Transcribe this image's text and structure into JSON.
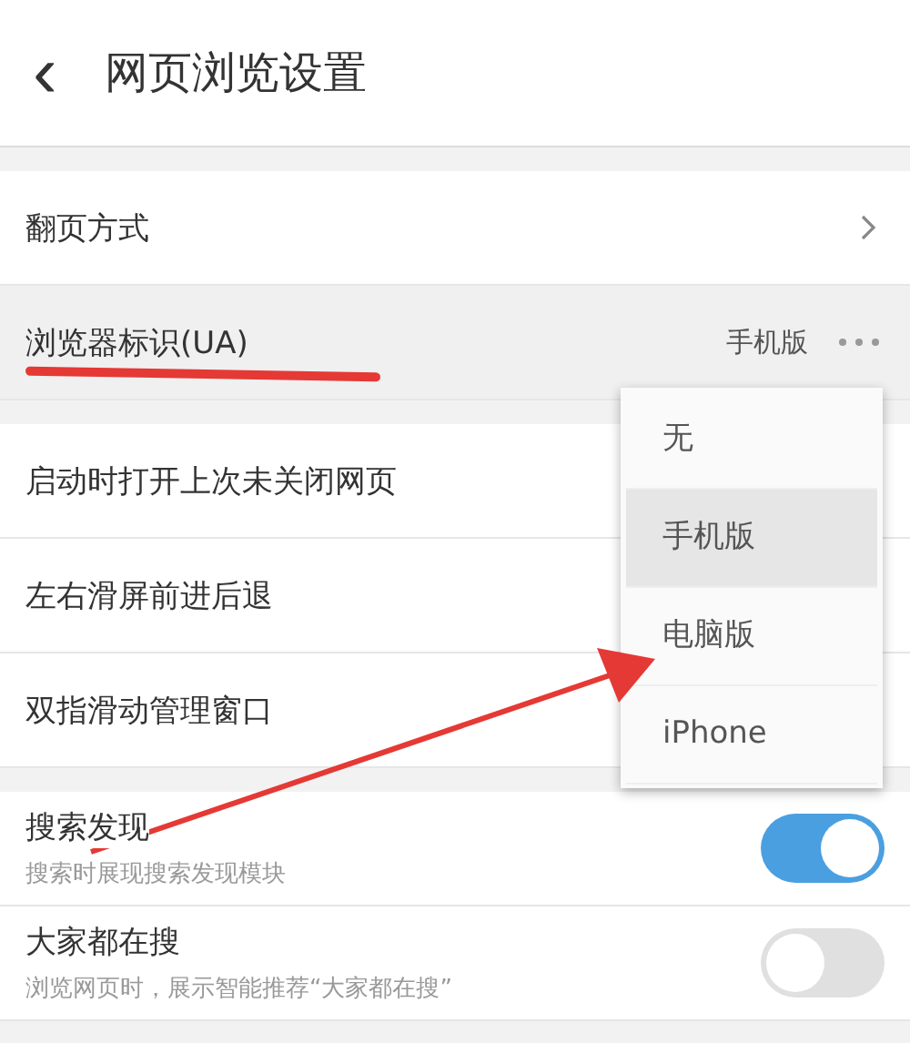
{
  "header": {
    "back": "‹",
    "title": "网页浏览设置"
  },
  "sections": [
    {
      "rows": [
        {
          "kind": "link",
          "label": "翻页方式",
          "highlighted": false
        },
        {
          "kind": "value",
          "label": "浏览器标识(UA)",
          "value": "手机版",
          "highlighted": true
        }
      ]
    },
    {
      "rows": [
        {
          "kind": "plain",
          "label": "启动时打开上次未关闭网页",
          "highlighted": false
        },
        {
          "kind": "plain",
          "label": "左右滑屏前进后退",
          "highlighted": false
        },
        {
          "kind": "plain",
          "label": "双指滑动管理窗口",
          "highlighted": false
        }
      ]
    },
    {
      "rows": [
        {
          "kind": "toggle",
          "label": "搜索发现",
          "subtitle": "搜索时展现搜索发现模块",
          "on": true,
          "highlighted": false
        },
        {
          "kind": "toggle",
          "label": "大家都在搜",
          "subtitle": "浏览网页时，展示智能推荐“大家都在搜”",
          "on": false,
          "highlighted": false
        }
      ]
    }
  ],
  "menu": {
    "items": [
      {
        "label": "无",
        "selected": false
      },
      {
        "label": "手机版",
        "selected": true
      },
      {
        "label": "电脑版",
        "selected": false
      },
      {
        "label": "iPhone",
        "selected": false
      }
    ]
  }
}
